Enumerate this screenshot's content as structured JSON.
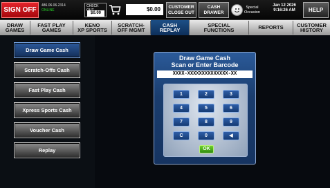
{
  "topbar": {
    "sign_off": "SIGN OFF",
    "terminal_id": "486.06.06.2314",
    "terminal_status": "ONLINE",
    "checkout_label": "CHECK OUT",
    "checkout_amount": "$0.00",
    "balance": "$0.00",
    "customer_closeout": "CUSTOMER\nCLOSE OUT",
    "cash_drawer": "CASH\nDRAWER",
    "special_occasion": "Special\nOccasion",
    "date": "Jan 12 2026",
    "time": "9:16:26 AM",
    "help": "HELP",
    "cart_icon": "shopping-cart-icon",
    "special_icon": "smiley-face-icon"
  },
  "tabs": [
    {
      "label": "DRAW\nGAMES"
    },
    {
      "label": "FAST PLAY\nGAMES"
    },
    {
      "label": "KENO\nXP SPORTS"
    },
    {
      "label": "SCRATCH-\nOFF MGMT"
    },
    {
      "label": "CASH\nREPLAY"
    },
    {
      "label": "SPECIAL\nFUNCTIONS"
    },
    {
      "label": "REPORTS"
    },
    {
      "label": "CUSTOMER\nHISTORY"
    }
  ],
  "active_tab": "CASH REPLAY",
  "left_nav": [
    {
      "label": "Draw Game Cash"
    },
    {
      "label": "Scratch-Offs Cash"
    },
    {
      "label": "Fast Play Cash"
    },
    {
      "label": "Xpress Sports Cash"
    },
    {
      "label": "Voucher Cash"
    },
    {
      "label": "Replay"
    }
  ],
  "dialog": {
    "title_line1": "Draw Game Cash",
    "title_line2": "Scan or Enter Barcode",
    "barcode_value": "XXXX-XXXXXXXXXXXXXX-XX",
    "keys": [
      "1",
      "2",
      "3",
      "4",
      "5",
      "6",
      "7",
      "8",
      "9",
      "C",
      "0",
      "◀"
    ],
    "ok_label": "OK"
  },
  "colors": {
    "sign_off": "#c8141b",
    "active_blue": "#1d4f86",
    "ok_green": "#4caf1e",
    "online_green": "#27d327"
  }
}
